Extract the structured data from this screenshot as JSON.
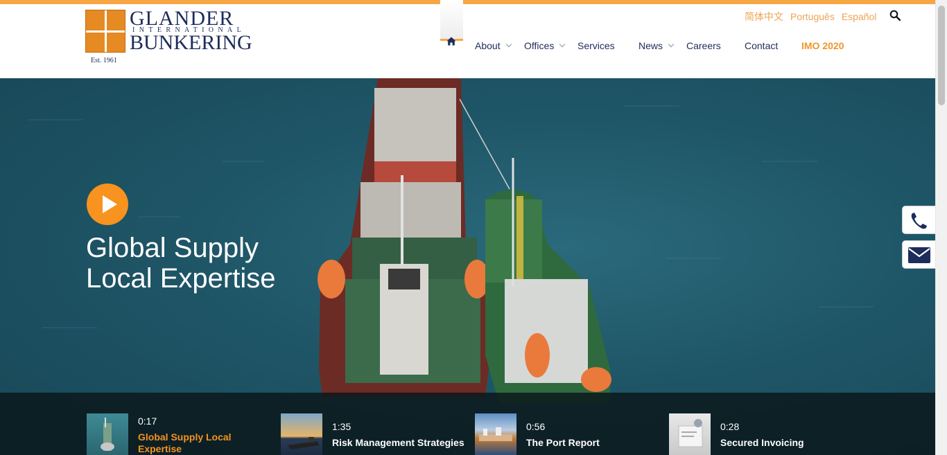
{
  "brand": {
    "name_line1": "GLANDER",
    "name_line2": "INTERNATIONAL",
    "name_line3": "BUNKERING",
    "established": "Est. 1961",
    "accent_color": "#f7a644",
    "navy_color": "#1d2c5a"
  },
  "languages": [
    "简体中文",
    "Português",
    "Español"
  ],
  "header_icons": {
    "search": "search-icon"
  },
  "nav": {
    "home_icon": "home-icon",
    "items": [
      {
        "label": "About",
        "has_dropdown": true
      },
      {
        "label": "Offices",
        "has_dropdown": true
      },
      {
        "label": "Services",
        "has_dropdown": false
      },
      {
        "label": "News",
        "has_dropdown": true
      },
      {
        "label": "Careers",
        "has_dropdown": false
      },
      {
        "label": "Contact",
        "has_dropdown": false
      },
      {
        "label": "IMO 2020",
        "has_dropdown": false,
        "highlight": true
      }
    ]
  },
  "hero": {
    "play_icon": "play-icon",
    "title_line1": "Global Supply",
    "title_line2": "Local Expertise"
  },
  "videos": [
    {
      "duration": "0:17",
      "title_line1": "Global Supply Local",
      "title_line2": "Expertise",
      "active": true
    },
    {
      "duration": "1:35",
      "title_line1": "Risk Management Strategies",
      "title_line2": "",
      "active": false
    },
    {
      "duration": "0:56",
      "title_line1": "The Port Report",
      "title_line2": "",
      "active": false
    },
    {
      "duration": "0:28",
      "title_line1": "Secured Invoicing",
      "title_line2": "",
      "active": false
    }
  ],
  "side_buttons": [
    "phone-icon",
    "envelope-icon"
  ]
}
